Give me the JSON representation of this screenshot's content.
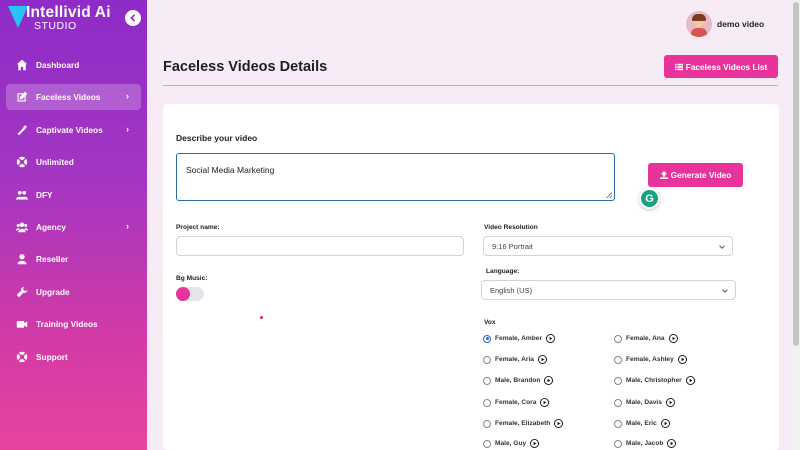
{
  "brand": {
    "name": "Intellivid Ai",
    "sub": "STUDIO",
    "accent": "#e8339a"
  },
  "user": {
    "name": "demo video"
  },
  "sidebar": {
    "items": [
      {
        "label": "Dashboard",
        "icon": "home-icon",
        "active": false,
        "has_arrow": false
      },
      {
        "label": "Faceless Videos",
        "icon": "edit-icon",
        "active": true,
        "has_arrow": true
      },
      {
        "label": "Captivate Videos",
        "icon": "magic-icon",
        "active": false,
        "has_arrow": true
      },
      {
        "label": "Unlimited",
        "icon": "infinity-icon",
        "active": false,
        "has_arrow": false
      },
      {
        "label": "DFY",
        "icon": "users-icon",
        "active": false,
        "has_arrow": false
      },
      {
        "label": "Agency",
        "icon": "group-icon",
        "active": false,
        "has_arrow": true
      },
      {
        "label": "Reseller",
        "icon": "user-icon",
        "active": false,
        "has_arrow": false
      },
      {
        "label": "Upgrade",
        "icon": "wrench-icon",
        "active": false,
        "has_arrow": false
      },
      {
        "label": "Training Videos",
        "icon": "video-icon",
        "active": false,
        "has_arrow": false
      },
      {
        "label": "Support",
        "icon": "support-icon",
        "active": false,
        "has_arrow": false
      }
    ]
  },
  "main": {
    "title": "Faceless Videos Details",
    "list_button": "Faceless Videos List",
    "describe_label": "Describe your video",
    "describe_value": "Social Media Marketing",
    "generate_button": "Generate Video",
    "project_name_label": "Project name:",
    "project_name_value": "",
    "bg_music_label": "Bg Music:",
    "bg_music_on": true,
    "resolution_label": "Video Resolution",
    "resolution_value": "9:16 Portrait",
    "language_label": "Language:",
    "language_value": "English (US)",
    "vox_label": "Vox",
    "voices_left": [
      "Female, Amber",
      "Female, Aria",
      "Male, Brandon",
      "Female, Cora",
      "Female, Elizabeth",
      "Male, Guy"
    ],
    "voices_right": [
      "Female, Ana",
      "Female, Ashley",
      "Male, Christopher",
      "Male, Davis",
      "Male, Eric",
      "Male, Jacob"
    ],
    "selected_voice": "Female, Amber"
  }
}
